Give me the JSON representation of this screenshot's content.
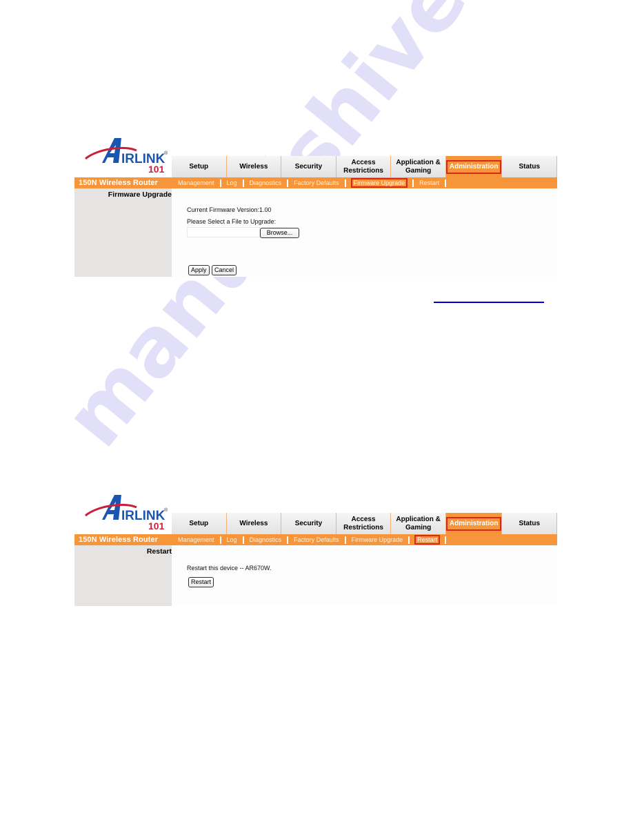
{
  "brand": {
    "logo_main": "IRLINK",
    "logo_initial": "A",
    "logo_sub": "101",
    "logo_reg": "®",
    "product_name": "150N Wireless Router",
    "colors": {
      "accent_orange": "#f7953a",
      "highlight_red": "#d8281a",
      "logo_blue": "#1a56b0",
      "logo_red": "#c8203a",
      "sidebar_gray": "#e6e4e3"
    }
  },
  "screenshots": [
    {
      "tabs": [
        {
          "label": "Setup"
        },
        {
          "label": "Wireless"
        },
        {
          "label": "Security"
        },
        {
          "label": "Access\nRestrictions"
        },
        {
          "label": "Application &\nGaming"
        },
        {
          "label": "Administration",
          "active": true
        },
        {
          "label": "Status"
        }
      ],
      "subnav": [
        {
          "label": "Management"
        },
        {
          "label": "Log"
        },
        {
          "label": "Diagnostics"
        },
        {
          "label": "Factory Defaults"
        },
        {
          "label": "Firmware Upgrade",
          "active": true
        },
        {
          "label": "Restart"
        }
      ],
      "sidebar_title": "Firmware Upgrade",
      "content": {
        "firmware_version_label": "Current Firmware Version:1.00",
        "select_file_label": "Please Select a File to Upgrade:",
        "file_input_value": "",
        "browse_label": "Browse...",
        "apply_label": "Apply",
        "cancel_label": "Cancel"
      }
    },
    {
      "tabs": [
        {
          "label": "Setup"
        },
        {
          "label": "Wireless"
        },
        {
          "label": "Security"
        },
        {
          "label": "Access\nRestrictions"
        },
        {
          "label": "Application &\nGaming"
        },
        {
          "label": "Administration",
          "active": true
        },
        {
          "label": "Status"
        }
      ],
      "subnav": [
        {
          "label": "Management"
        },
        {
          "label": "Log"
        },
        {
          "label": "Diagnostics"
        },
        {
          "label": "Factory Defaults"
        },
        {
          "label": "Firmware Upgrade"
        },
        {
          "label": "Restart",
          "active": true
        }
      ],
      "sidebar_title": "Restart",
      "content": {
        "restart_text": "Restart this device -- AR670W.",
        "restart_label": "Restart"
      }
    }
  ],
  "watermark": "manualshive.com"
}
